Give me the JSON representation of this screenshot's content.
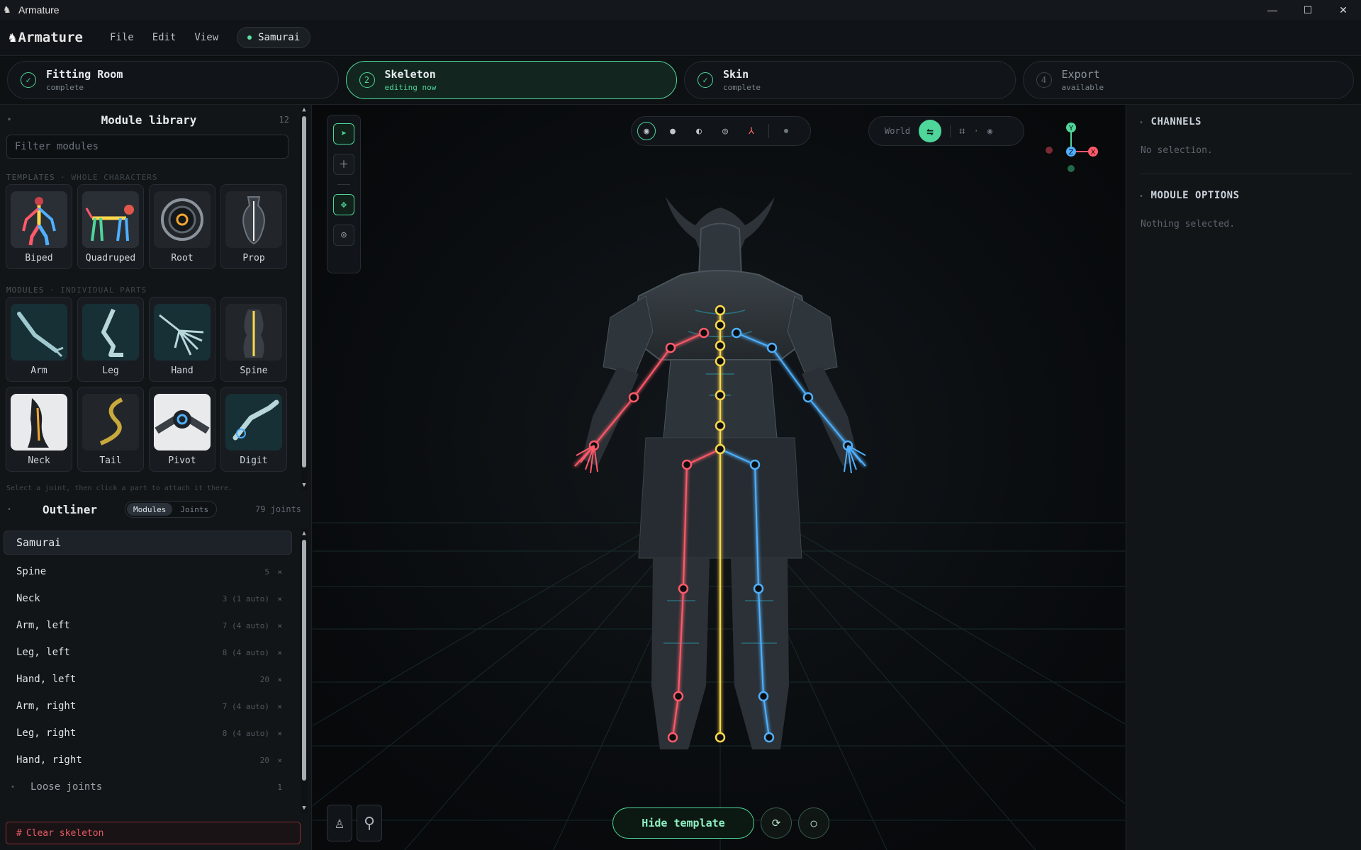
{
  "window": {
    "title": "Armature"
  },
  "app": {
    "logo_text": "Armature",
    "menus": [
      "File",
      "Edit",
      "View"
    ],
    "project": "Samurai"
  },
  "steps": [
    {
      "num": "✓",
      "name": "Fitting Room",
      "status": "complete"
    },
    {
      "num": "2",
      "name": "Skeleton",
      "status": "editing now"
    },
    {
      "num": "✓",
      "name": "Skin",
      "status": "complete"
    },
    {
      "num": "4",
      "name": "Export",
      "status": "available"
    }
  ],
  "library": {
    "title": "Module library",
    "count": "12",
    "filter_placeholder": "Filter modules",
    "templates_label": "TEMPLATES",
    "templates_sub": "· WHOLE CHARACTERS",
    "templates": [
      "Biped",
      "Quadruped",
      "Root",
      "Prop"
    ],
    "modules_label": "MODULES",
    "modules_sub": "· INDIVIDUAL PARTS",
    "modules": [
      "Arm",
      "Leg",
      "Hand",
      "Spine",
      "Neck",
      "Tail",
      "Pivot",
      "Digit"
    ],
    "hint": "Select a joint, then click a part to attach it there."
  },
  "outliner": {
    "title": "Outliner",
    "tabs": [
      "Modules",
      "Joints"
    ],
    "joint_count": "79 joints",
    "root": "Samurai",
    "items": [
      {
        "name": "Spine",
        "count": "5"
      },
      {
        "name": "Neck",
        "count": "3 (1 auto)"
      },
      {
        "name": "Arm, left",
        "count": "7 (4 auto)"
      },
      {
        "name": "Leg, left",
        "count": "8 (4 auto)"
      },
      {
        "name": "Hand, left",
        "count": "20"
      },
      {
        "name": "Arm, right",
        "count": "7 (4 auto)"
      },
      {
        "name": "Leg, right",
        "count": "8 (4 auto)"
      },
      {
        "name": "Hand, right",
        "count": "20"
      }
    ],
    "loose": {
      "name": "Loose joints",
      "count": "1"
    },
    "remove_glyph": "×",
    "clear_label": "Clear skeleton"
  },
  "viewport": {
    "space_label": "World",
    "hide_template_label": "Hide template",
    "gizmo": {
      "y": "Y",
      "x": "X",
      "z": "Z"
    },
    "colors": {
      "left": "#ff5a6a",
      "right": "#4fb0ff",
      "center": "#ffd84a",
      "accent": "#4fd69a"
    }
  },
  "inspector": {
    "channels_title": "CHANNELS",
    "channels_note": "No selection.",
    "options_title": "MODULE OPTIONS",
    "options_note": "Nothing selected."
  }
}
